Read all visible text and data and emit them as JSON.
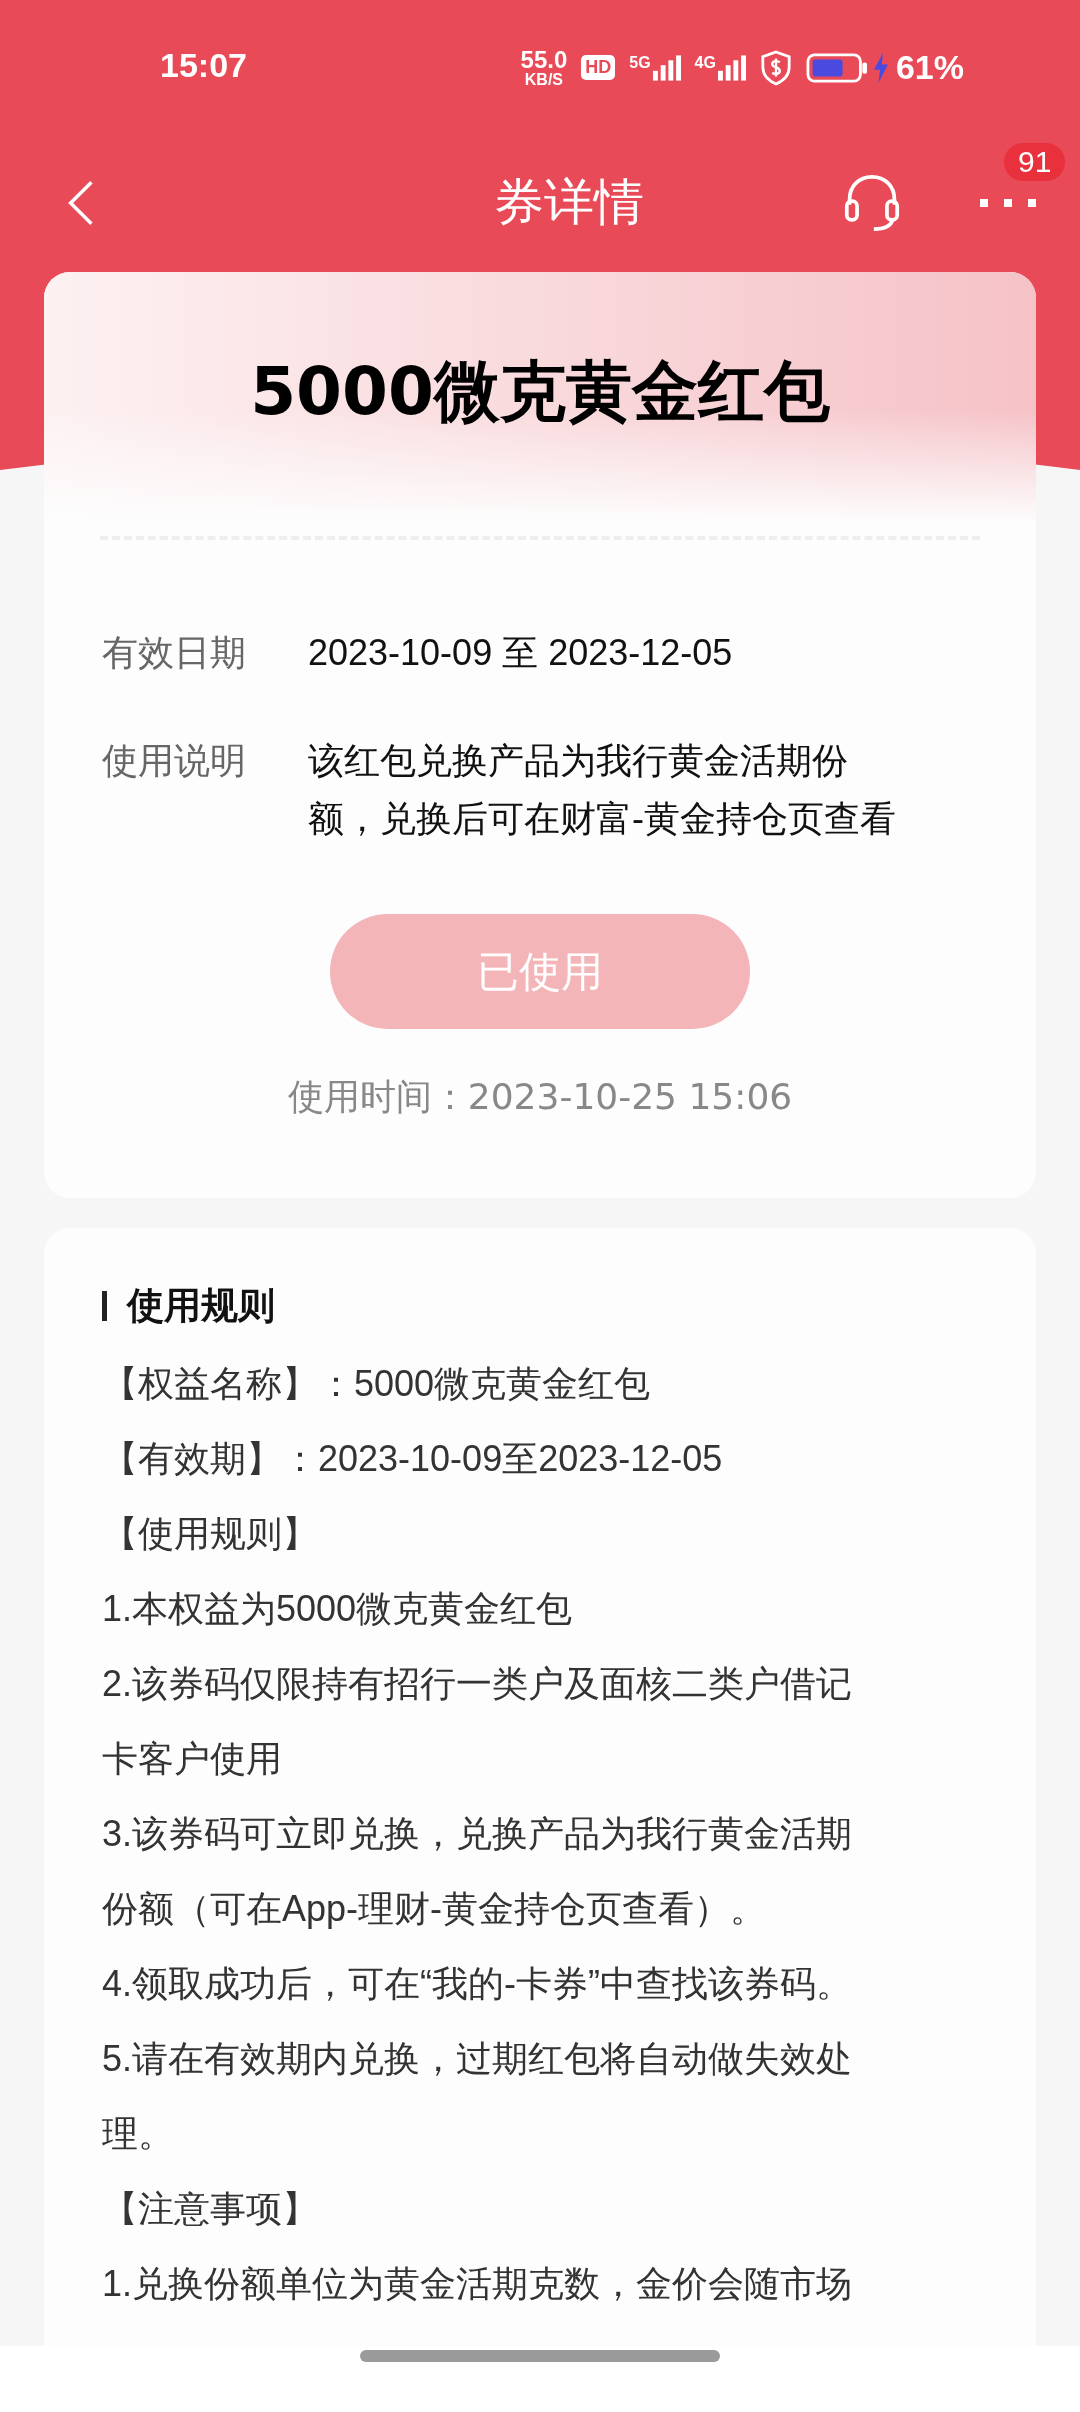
{
  "status_bar": {
    "time": "15:07",
    "net_speed": "55.0",
    "net_unit": "KB/S",
    "hd": "HD",
    "sim1": "5G",
    "sim2": "4G",
    "battery_text": "61%",
    "charging": true
  },
  "nav": {
    "title": "券详情",
    "badge": "91"
  },
  "coupon": {
    "title": "5000微克黄金红包",
    "fields": [
      {
        "label": "有效日期",
        "value": "2023-10-09 至 2023-12-05"
      },
      {
        "label": "使用说明",
        "value": "该红包兑换产品为我行黄金活期份额，兑换后可在财富-黄金持仓页查看"
      }
    ],
    "button": {
      "label": "已使用",
      "disabled": true
    },
    "used_time": "使用时间：2023-10-25 15:06"
  },
  "rules": {
    "heading": "使用规则",
    "lines": [
      "【权益名称】：5000微克黄金红包",
      "【有效期】：2023-10-09至2023-12-05",
      "【使用规则】",
      "1.本权益为5000微克黄金红包",
      "2.该券码仅限持有招行一类户及面核二类户借记卡客户使用",
      "3.该券码可立即兑换，兑换产品为我行黄金活期份额（可在App-理财-黄金持仓页查看）。",
      "4.领取成功后，可在“我的-卡券”中查找该券码。",
      "5.请在有效期内兑换，过期红包将自动做失效处理。",
      "【注意事项】",
      "1.兑换份额单位为黄金活期克数，金价会随市场"
    ]
  }
}
